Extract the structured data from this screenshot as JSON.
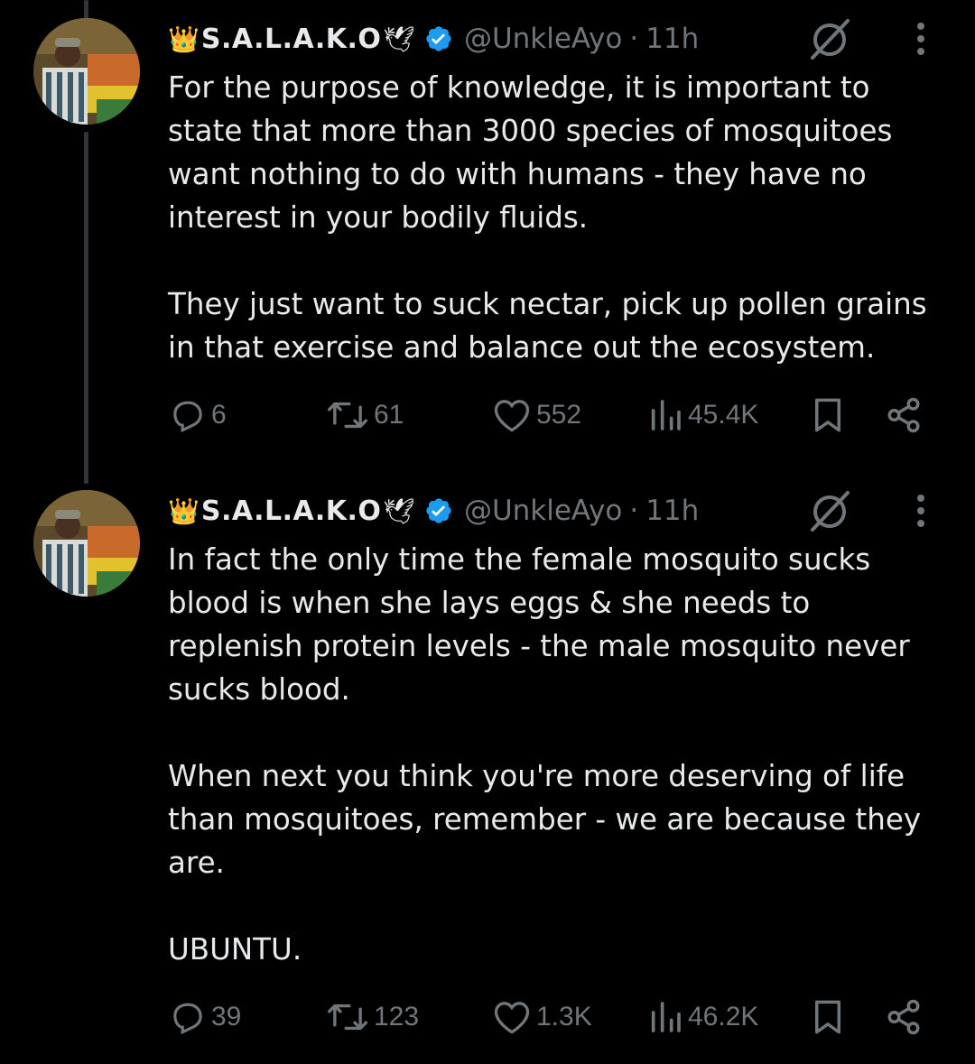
{
  "tweets": [
    {
      "author": {
        "crown": "👑",
        "display_name": "S.A.L.A.K.O",
        "dove": "🕊",
        "handle": "@UnkleAyo",
        "separator": "·",
        "time": "11h"
      },
      "text": [
        "For the purpose of knowledge, it is important to state that more than 3000 species of mosquitoes want nothing to do with humans - they have no interest in your bodily fluids.",
        "They just want to suck nectar, pick up pollen grains in that exercise and balance out the ecosystem."
      ],
      "stats": {
        "replies": "6",
        "reposts": "61",
        "likes": "552",
        "views": "45.4K"
      }
    },
    {
      "author": {
        "crown": "👑",
        "display_name": "S.A.L.A.K.O",
        "dove": "🕊",
        "handle": "@UnkleAyo",
        "separator": "·",
        "time": "11h"
      },
      "text": [
        "In fact the only time the female mosquito sucks blood is when she lays eggs & she needs to replenish protein levels - the male mosquito never sucks blood.",
        "When next you think you're more deserving of life than mosquitoes, remember - we are because they are.",
        "UBUNTU."
      ],
      "stats": {
        "replies": "39",
        "reposts": "123",
        "likes": "1.3K",
        "views": "46.2K"
      }
    }
  ],
  "icons": {
    "reply": "reply-icon",
    "repost": "repost-icon",
    "like": "heart-icon",
    "views": "views-icon",
    "bookmark": "bookmark-icon",
    "share": "share-icon",
    "grok": "grok-icon",
    "more": "more-icon",
    "verified": "verified-badge-icon"
  },
  "colors": {
    "background": "#000000",
    "text": "#e7e9ea",
    "muted": "#71767b",
    "verified": "#1d9bf0",
    "thread_line": "#333639"
  }
}
